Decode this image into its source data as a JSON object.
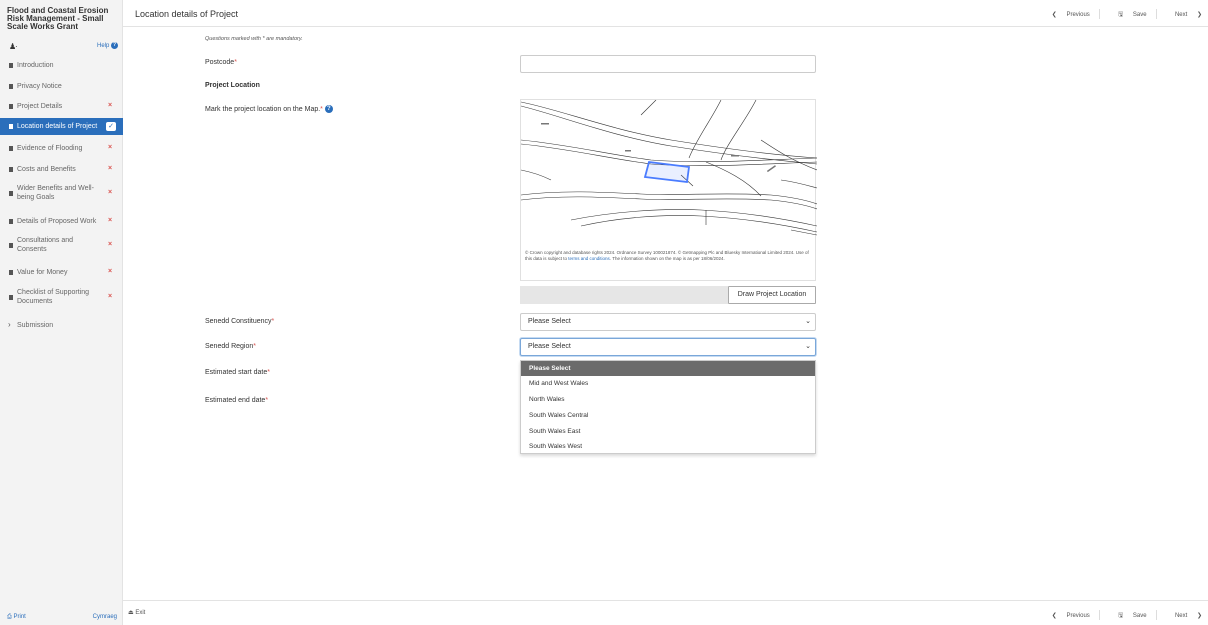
{
  "app": {
    "title": "Flood and Coastal Erosion Risk Management - Small Scale Works Grant"
  },
  "user": {
    "glyph": "♟",
    "name": "·",
    "help_label": "Help"
  },
  "sidebar": {
    "items": [
      {
        "label": "Introduction"
      },
      {
        "label": "Privacy Notice"
      },
      {
        "label": "Project Details",
        "status": "×"
      },
      {
        "label": "Location details of Project",
        "status": "✓"
      },
      {
        "label": "Evidence of Flooding",
        "status": "×"
      },
      {
        "label": "Costs and Benefits",
        "status": "×"
      },
      {
        "label": "Wider Benefits and Well-being Goals",
        "status": "×"
      },
      {
        "label": "Details of Proposed Work",
        "status": "×"
      },
      {
        "label": "Consultations and Consents",
        "status": "×"
      },
      {
        "label": "Value for Money",
        "status": "×"
      },
      {
        "label": "Checklist of Supporting Documents",
        "status": "×"
      },
      {
        "label": "Submission"
      }
    ],
    "print_label": "Print",
    "language_label": "Cymraeg"
  },
  "header": {
    "title": "Location details of Project",
    "previous_label": "Previous",
    "save_label": "Save",
    "next_label": "Next"
  },
  "footer": {
    "exit_label": "Exit"
  },
  "form": {
    "mandatory_note": "Questions marked with * are mandatory.",
    "postcode": {
      "label": "Postcode",
      "value": ""
    },
    "project_location_heading": "Project Location",
    "map_label": "Mark the project location on the Map.",
    "map": {
      "attribution_prefix": "© Crown copyright and database rights 2024. Ordnance Survey 100021874. © Getmapping Plc and Bluesky International Limited 2024. Use of this data is subject to ",
      "attribution_link": "terms and conditions",
      "attribution_suffix": ". The information shown on the map is as per 18/06/2024.",
      "draw_button": "Draw Project Location"
    },
    "constituency": {
      "label": "Senedd Constituency",
      "value": "Please Select"
    },
    "region": {
      "label": "Senedd Region",
      "value": "Please Select",
      "options": [
        "Please Select",
        "Mid and West Wales",
        "North Wales",
        "South Wales Central",
        "South Wales East",
        "South Wales West"
      ]
    },
    "start_date": {
      "label": "Estimated start date"
    },
    "end_date": {
      "label": "Estimated end date"
    }
  },
  "colors": {
    "accent": "#2a6ebb",
    "required": "#d9534f",
    "selected_option": "#6b6b6b"
  }
}
